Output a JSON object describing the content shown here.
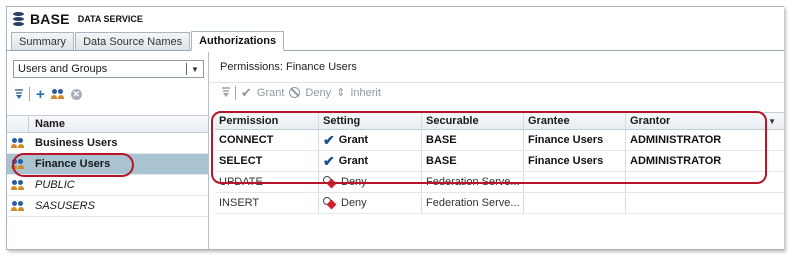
{
  "app": {
    "title": "BASE",
    "subtitle": "DATA SERVICE",
    "icon": "database-icon"
  },
  "tabs": [
    {
      "label": "Summary",
      "active": false
    },
    {
      "label": "Data Source Names",
      "active": false
    },
    {
      "label": "Authorizations",
      "active": true
    }
  ],
  "left_panel": {
    "filter_select": {
      "value": "Users and Groups"
    },
    "column_header": "Name",
    "rows": [
      {
        "name": "Business Users",
        "style": "bold",
        "selected": false
      },
      {
        "name": "Finance Users",
        "style": "bold",
        "selected": true
      },
      {
        "name": "PUBLIC",
        "style": "italic",
        "selected": false
      },
      {
        "name": "SASUSERS",
        "style": "italic",
        "selected": false
      }
    ]
  },
  "right_panel": {
    "permissions_title": "Permissions: Finance Users",
    "toolbar": {
      "grant_label": "Grant",
      "deny_label": "Deny",
      "inherit_label": "Inherit"
    },
    "columns": [
      "Permission",
      "Setting",
      "Securable",
      "Grantee",
      "Grantor"
    ],
    "rows": [
      {
        "permission": "CONNECT",
        "setting": "Grant",
        "setting_icon": "check-icon",
        "securable": "BASE",
        "grantee": "Finance Users",
        "grantor": "ADMINISTRATOR",
        "highlight": true
      },
      {
        "permission": "SELECT",
        "setting": "Grant",
        "setting_icon": "check-icon",
        "securable": "BASE",
        "grantee": "Finance Users",
        "grantor": "ADMINISTRATOR",
        "highlight": true
      },
      {
        "permission": "UPDATE",
        "setting": "Deny",
        "setting_icon": "deny-icon",
        "securable": "Federation Serve...",
        "grantee": "",
        "grantor": "",
        "highlight": false
      },
      {
        "permission": "INSERT",
        "setting": "Deny",
        "setting_icon": "deny-icon",
        "securable": "Federation Serve...",
        "grantee": "",
        "grantor": "",
        "highlight": false
      }
    ]
  },
  "colors": {
    "selection": "#a9c3d1",
    "callout": "#b5162a",
    "grant_check": "#1f4f8f",
    "deny_red": "#d0202e"
  }
}
